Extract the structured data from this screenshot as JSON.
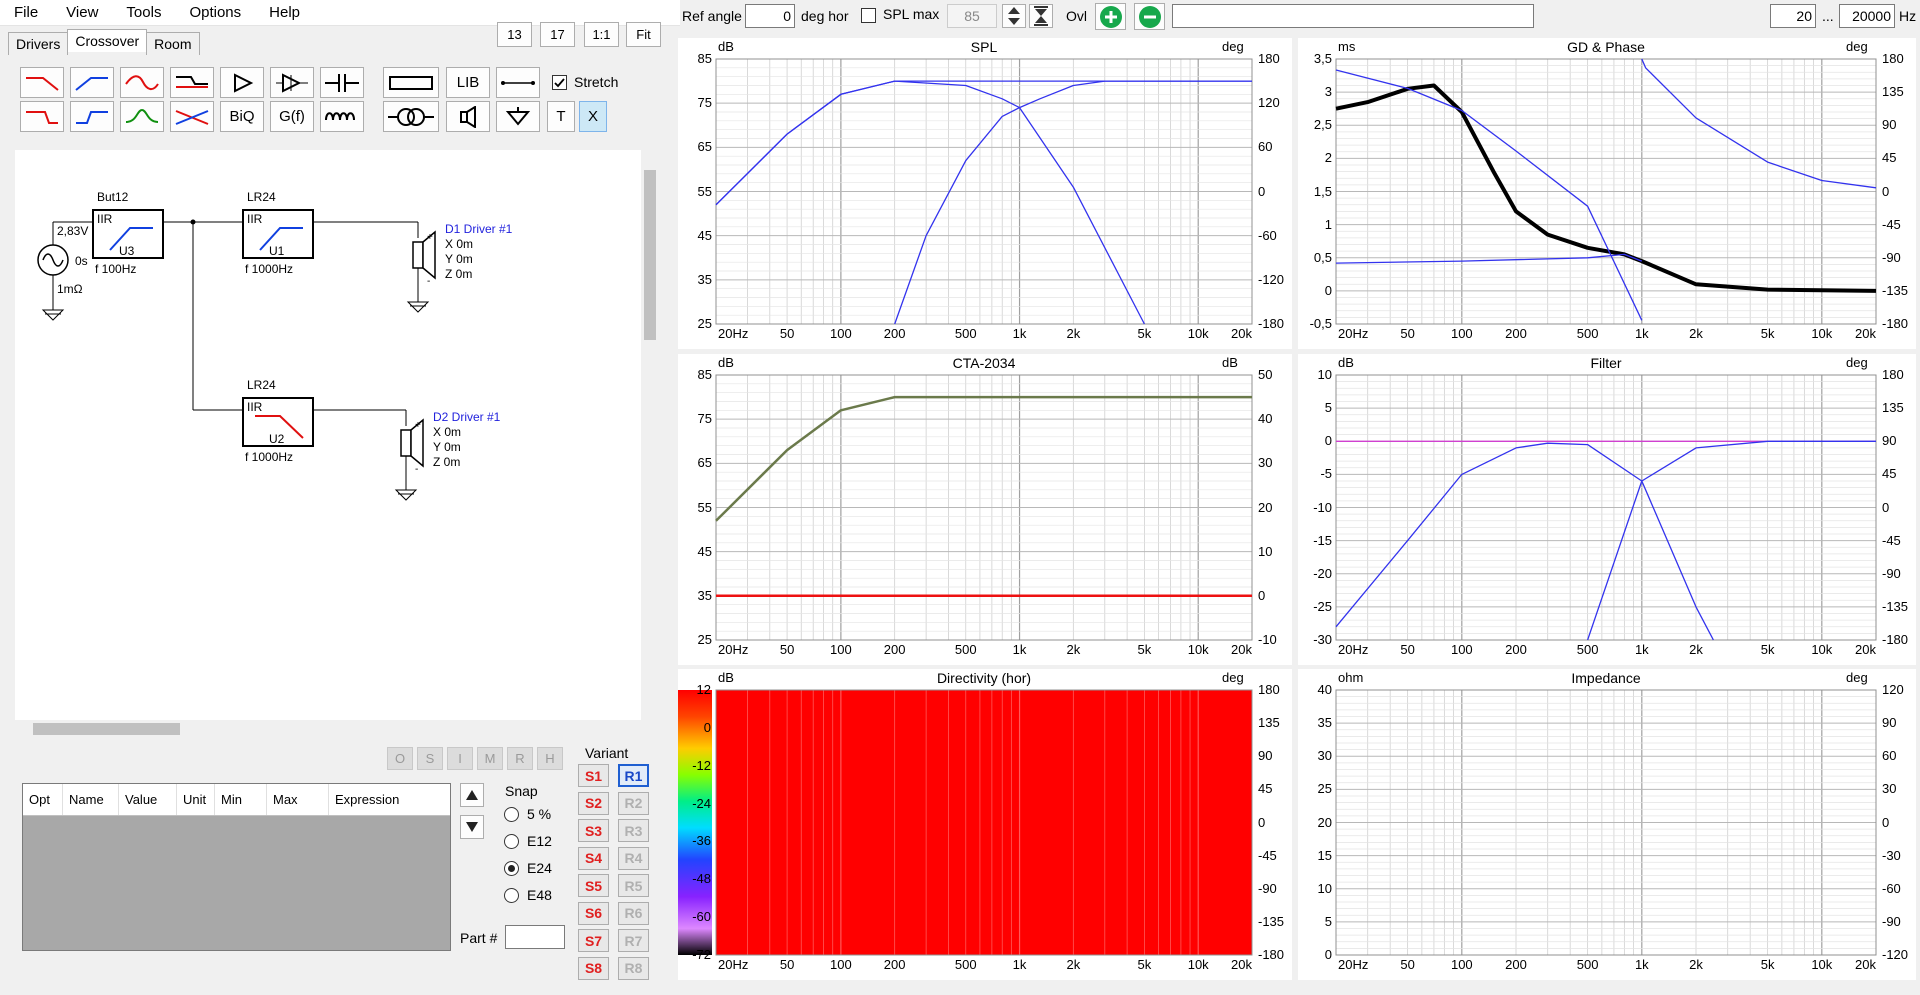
{
  "menu": [
    "File",
    "View",
    "Tools",
    "Options",
    "Help"
  ],
  "tabs": [
    "Drivers",
    "Crossover",
    "Room"
  ],
  "zoom_buttons": [
    "13",
    "17",
    "1:1",
    "Fit"
  ],
  "toolbox": {
    "lib": "LIB",
    "biq": "BiQ",
    "gf": "G(f)",
    "t": "T",
    "x": "X",
    "stretch": "Stretch",
    "stretch_checked": true
  },
  "schematic": {
    "source_voltage": "2,83V",
    "source_delay": "0s",
    "source_r": "1mΩ",
    "blocks": [
      {
        "name": "But12",
        "type": "IIR",
        "id": "U3",
        "freq": "f   100Hz"
      },
      {
        "name": "LR24",
        "type": "IIR",
        "id": "U1",
        "freq": "f   1000Hz"
      },
      {
        "name": "LR24",
        "type": "IIR",
        "id": "U2",
        "freq": "f   1000Hz"
      }
    ],
    "drivers": [
      {
        "name": "D1 Driver #1",
        "x": "X 0m",
        "y": "Y 0m",
        "z": "Z 0m"
      },
      {
        "name": "D2 Driver #1",
        "x": "X 0m",
        "y": "Y 0m",
        "z": "Z 0m"
      }
    ]
  },
  "optimizer_buttons": [
    "O",
    "S",
    "I",
    "M",
    "R",
    "H"
  ],
  "param_table": {
    "columns": [
      "Opt",
      "Name",
      "Value",
      "Unit",
      "Min",
      "Max",
      "Expression"
    ]
  },
  "snap": {
    "label": "Snap",
    "options": [
      "5 %",
      "E12",
      "E24",
      "E48"
    ],
    "selected": "E24"
  },
  "part_label": "Part #",
  "variant": {
    "label": "Variant",
    "s": [
      "S1",
      "S2",
      "S3",
      "S4",
      "S5",
      "S6",
      "S7",
      "S8"
    ],
    "r": [
      "R1",
      "R2",
      "R3",
      "R4",
      "R5",
      "R6",
      "R7",
      "R8"
    ],
    "active": "R1"
  },
  "top_toolbar": {
    "ref_angle_label": "Ref angle",
    "ref_angle": "0",
    "deg_hor": "deg hor",
    "spl_max_label": "SPL max",
    "spl_max": "85",
    "ovl": "Ovl",
    "f_min": "20",
    "dots": "...",
    "f_max": "20000",
    "hz": "Hz"
  },
  "colors": {
    "blue": "#3333ee",
    "red": "#ee1111",
    "olive": "#6b7a4b",
    "magenta": "#d040d0",
    "grid": "#d0d0d0"
  },
  "x_ticks": [
    "20Hz",
    "50",
    "100",
    "200",
    "500",
    "1k",
    "2k",
    "5k",
    "10k",
    "20k"
  ],
  "graphs": {
    "spl": {
      "title": "SPL",
      "lunit": "dB",
      "runit": "deg",
      "left": [
        "85",
        "75",
        "65",
        "55",
        "45",
        "35",
        "25"
      ],
      "right": [
        "180",
        "120",
        "60",
        "0",
        "-60",
        "-120",
        "-180"
      ]
    },
    "gd": {
      "title": "GD & Phase",
      "lunit": "ms",
      "runit": "deg",
      "left": [
        "3,5",
        "3",
        "2,5",
        "2",
        "1,5",
        "1",
        "0,5",
        "0",
        "-0,5"
      ],
      "right": [
        "180",
        "135",
        "90",
        "45",
        "0",
        "-45",
        "-90",
        "-135",
        "-180"
      ]
    },
    "cta": {
      "title": "CTA-2034",
      "lunit": "dB",
      "runit": "dB",
      "left": [
        "85",
        "75",
        "65",
        "55",
        "45",
        "35",
        "25"
      ],
      "right": [
        "50",
        "40",
        "30",
        "20",
        "10",
        "0",
        "-10"
      ]
    },
    "filter": {
      "title": "Filter",
      "lunit": "dB",
      "runit": "deg",
      "left": [
        "10",
        "5",
        "0",
        "-5",
        "-10",
        "-15",
        "-20",
        "-25",
        "-30"
      ],
      "right": [
        "180",
        "135",
        "90",
        "45",
        "0",
        "-45",
        "-90",
        "-135",
        "-180"
      ]
    },
    "dir": {
      "title": "Directivity (hor)",
      "lunit": "dB",
      "runit": "deg",
      "left": [
        "12",
        "0",
        "-12",
        "-24",
        "-36",
        "-48",
        "-60",
        "-72"
      ],
      "right": [
        "180",
        "135",
        "90",
        "45",
        "0",
        "-45",
        "-90",
        "-135",
        "-180"
      ]
    },
    "imp": {
      "title": "Impedance",
      "lunit": "ohm",
      "runit": "deg",
      "left": [
        "40",
        "35",
        "30",
        "25",
        "20",
        "15",
        "10",
        "5",
        "0"
      ],
      "right": [
        "120",
        "90",
        "60",
        "30",
        "0",
        "-30",
        "-60",
        "-90",
        "-120"
      ]
    }
  },
  "chart_data": [
    {
      "type": "line",
      "title": "SPL",
      "x_scale": "log",
      "xlim": [
        20,
        20000
      ],
      "ylim": [
        25,
        85
      ],
      "ylabel": "dB",
      "y2label": "deg",
      "y2lim": [
        -180,
        180
      ],
      "series": [
        {
          "color": "blue",
          "x": [
            20,
            50,
            100,
            200,
            500,
            1000,
            2000,
            5000,
            10000,
            20000
          ],
          "y": [
            52,
            68,
            77,
            80,
            80,
            80,
            80,
            80,
            80,
            80
          ]
        },
        {
          "color": "blue",
          "x": [
            200,
            300,
            500,
            800,
            1000,
            2000,
            5000
          ],
          "y": [
            25,
            45,
            62,
            72,
            74,
            56,
            25
          ]
        },
        {
          "color": "blue",
          "x": [
            20,
            50,
            100,
            200,
            500,
            800,
            1000,
            1300,
            2000,
            3000,
            5000,
            20000
          ],
          "y": [
            52,
            68,
            77,
            80,
            79,
            76,
            74,
            76,
            79,
            80,
            80,
            80
          ]
        }
      ]
    },
    {
      "type": "line",
      "title": "GD & Phase",
      "x_scale": "log",
      "xlim": [
        20,
        20000
      ],
      "ylim": [
        -0.5,
        3.5
      ],
      "ylabel": "ms",
      "y2label": "deg",
      "y2lim": [
        -180,
        180
      ],
      "series": [
        {
          "color": "black",
          "x": [
            20,
            30,
            50,
            70,
            100,
            150,
            200,
            300,
            500,
            800,
            1000,
            2000,
            5000,
            20000
          ],
          "y": [
            2.75,
            2.85,
            3.05,
            3.1,
            2.7,
            1.8,
            1.2,
            0.85,
            0.65,
            0.55,
            0.45,
            0.1,
            0.02,
            0.0
          ]
        },
        {
          "color": "blue",
          "x": [
            20,
            50,
            100,
            200,
            500,
            1000
          ],
          "y": [
            165,
            140,
            110,
            55,
            -20,
            -175
          ]
        },
        {
          "color": "blue",
          "x": [
            1000,
            1050,
            2000,
            5000,
            10000,
            20000
          ],
          "y": [
            180,
            168,
            100,
            40,
            15,
            5
          ]
        },
        {
          "color": "blue",
          "x": [
            20,
            100,
            500,
            800,
            1000
          ],
          "y": [
            0.42,
            0.45,
            0.5,
            0.55,
            0.45
          ]
        }
      ]
    },
    {
      "type": "line",
      "title": "CTA-2034",
      "x_scale": "log",
      "xlim": [
        20,
        20000
      ],
      "ylim": [
        25,
        85
      ],
      "ylabel": "dB",
      "y2label": "dB",
      "y2lim": [
        -10,
        50
      ],
      "series": [
        {
          "color": "olive",
          "x": [
            20,
            50,
            100,
            200,
            500,
            1000,
            20000
          ],
          "y": [
            52,
            68,
            77,
            80,
            80,
            80,
            80
          ]
        },
        {
          "color": "red",
          "x": [
            20,
            20000
          ],
          "y": [
            35,
            35
          ]
        }
      ]
    },
    {
      "type": "line",
      "title": "Filter",
      "x_scale": "log",
      "xlim": [
        20,
        20000
      ],
      "ylim": [
        -30,
        10
      ],
      "ylabel": "dB",
      "y2label": "deg",
      "y2lim": [
        -180,
        180
      ],
      "series": [
        {
          "color": "magenta",
          "x": [
            20,
            20000
          ],
          "y": [
            0,
            0
          ]
        },
        {
          "color": "blue",
          "x": [
            20,
            50,
            100,
            200,
            300,
            500,
            1000,
            2000,
            2500
          ],
          "y": [
            -28,
            -15,
            -5,
            -1,
            -0.3,
            -0.5,
            -6,
            -25,
            -30
          ]
        },
        {
          "color": "blue",
          "x": [
            500,
            1000,
            2000,
            5000,
            20000
          ],
          "y": [
            -30,
            -6,
            -1,
            0,
            0
          ]
        }
      ]
    },
    {
      "type": "heatmap",
      "title": "Directivity (hor)",
      "x_scale": "log",
      "xlim": [
        20,
        20000
      ],
      "ylim": [
        -180,
        180
      ],
      "ylabel": "dB",
      "y2label": "deg",
      "colorbar": [
        12,
        0,
        -12,
        -24,
        -36,
        -48,
        -60,
        -72
      ],
      "values": "uniform 12 dB"
    },
    {
      "type": "line",
      "title": "Impedance",
      "x_scale": "log",
      "xlim": [
        20,
        20000
      ],
      "ylim": [
        0,
        40
      ],
      "ylabel": "ohm",
      "y2label": "deg",
      "y2lim": [
        -120,
        120
      ],
      "series": []
    }
  ]
}
